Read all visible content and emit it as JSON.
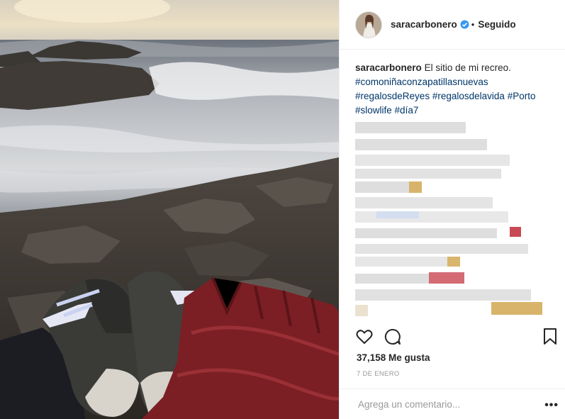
{
  "post": {
    "username": "saracarbonero",
    "follow_state": "Seguido",
    "caption_username": "saracarbonero",
    "caption_text": "El sitio de mi recreo.",
    "hashtags": [
      "#comoniñaconzapatillasnuevas",
      "#regalosdeReyes",
      "#regalosdelavida",
      "#Porto",
      "#slowlife",
      "#día7"
    ],
    "likes": "37,158 Me gusta",
    "date": "7 DE ENERO",
    "comment_placeholder": "Agrega un comentario...",
    "more_label": "•••"
  },
  "colors": {
    "link": "#003569",
    "verified": "#3897f0",
    "text": "#262626",
    "muted": "#999999"
  },
  "icons": [
    "verified-badge-icon",
    "heart-icon",
    "comment-icon",
    "bookmark-icon",
    "more-options-icon"
  ]
}
